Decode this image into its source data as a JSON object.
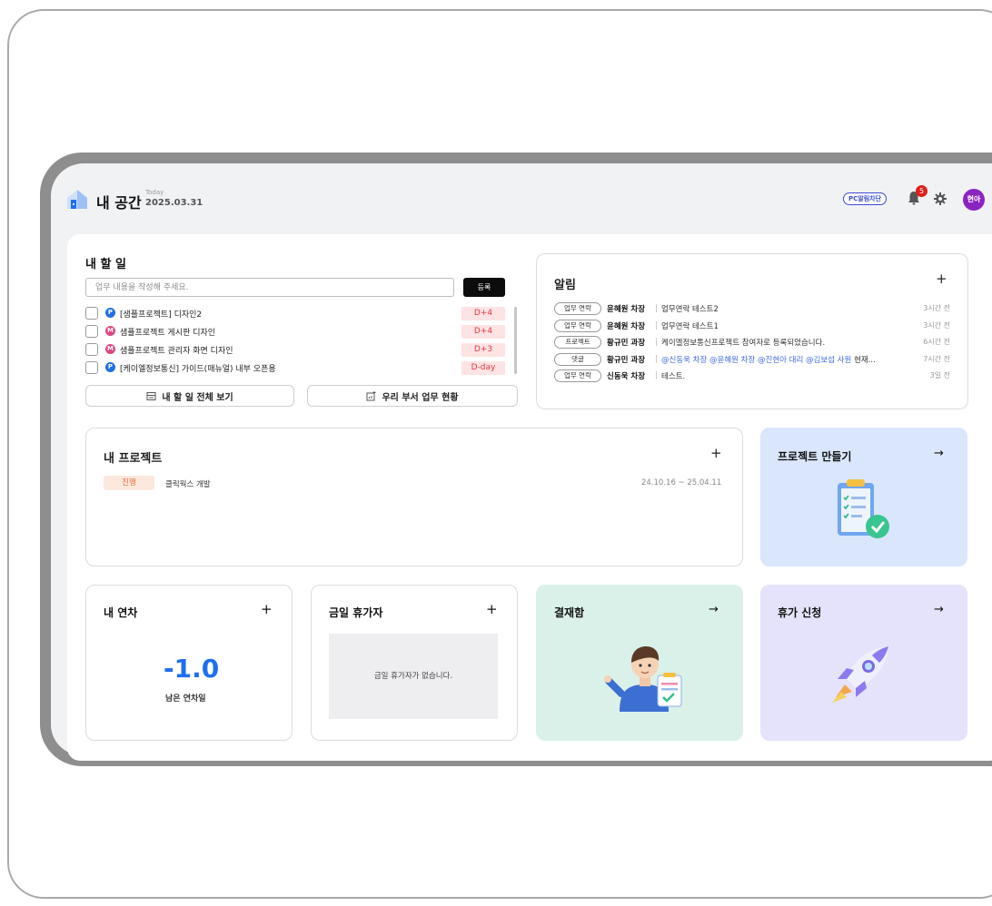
{
  "header": {
    "title": "내 공간",
    "today_label": "Today",
    "date": "2025.03.31",
    "pc_button": "PC알림차단",
    "notification_count": "5",
    "avatar_text": "현아"
  },
  "todo": {
    "title": "내 할 일",
    "input_placeholder": "업무 내용을 작성해 주세요.",
    "add_button": "등록",
    "items": [
      {
        "tag": "P",
        "tag_color": "#1f6fe5",
        "text": "[샘플프로젝트] 디자인2",
        "dday": "D+4",
        "dday_bg": "#fde3e3",
        "dday_color": "#e0383e"
      },
      {
        "tag": "M",
        "tag_color": "#e0457e",
        "text": "샘플프로젝트 게시판 디자인",
        "dday": "D+4",
        "dday_bg": "#fde3e3",
        "dday_color": "#e0383e"
      },
      {
        "tag": "M",
        "tag_color": "#e0457e",
        "text": "샘플프로젝트 관리자 화면 디자인",
        "dday": "D+3",
        "dday_bg": "#fde3e3",
        "dday_color": "#e0383e"
      },
      {
        "tag": "P",
        "tag_color": "#1f6fe5",
        "text": "[케이엘정보통신] 가이드(매뉴얼) 내부 오픈용",
        "dday": "D-day",
        "dday_bg": "#fde3e3",
        "dday_color": "#e0383e"
      }
    ],
    "view_all_button": "내 할 일 전체 보기",
    "dept_button": "우리 부서 업무 현황"
  },
  "notifications": {
    "title": "알림",
    "items": [
      {
        "type": "업무 연락",
        "name": "윤혜원 차장",
        "text": "업무연락 테스트2",
        "time": "3시간 전"
      },
      {
        "type": "업무 연락",
        "name": "윤혜원 차장",
        "text": "업무연락 테스트1",
        "time": "3시간 전"
      },
      {
        "type": "프로젝트",
        "name": "황규민 과장",
        "text": "케이엘정보통신프로젝트 참여자로 등록되었습니다.",
        "time": "6시간 전"
      },
      {
        "type": "댓글",
        "name": "황규민 과장",
        "mention": "@신동욱 차장 @윤혜원 차장 @진현아 대리 @김보섭 사원",
        "text": " 현재...",
        "time": "7시간 전"
      },
      {
        "type": "업무 연락",
        "name": "신동욱 차장",
        "text": "테스트.",
        "time": "3일 전"
      }
    ]
  },
  "projects": {
    "title": "내 프로젝트",
    "items": [
      {
        "status": "진행",
        "name": "클릭웍스 개발",
        "period": "24.10.16 ~ 25.04.11"
      }
    ]
  },
  "create_project": {
    "title": "프로젝트 만들기"
  },
  "annual_leave": {
    "title": "내 연차",
    "value": "-1.0",
    "label": "남은 연차일"
  },
  "today_off": {
    "title": "금일 휴가자",
    "empty_text": "금일 휴가자가 없습니다."
  },
  "approval": {
    "title": "결재함"
  },
  "leave_request": {
    "title": "휴가 신청"
  },
  "icons": {
    "plus": "+",
    "arrow": "→"
  },
  "colors": {
    "accent_blue": "#1d6ff2",
    "create_tile_bg": "#d9e6fc",
    "approval_tile_bg": "#daf1ea",
    "leave_tile_bg": "#e4e3fb",
    "avatar_bg": "#8a24c0"
  }
}
